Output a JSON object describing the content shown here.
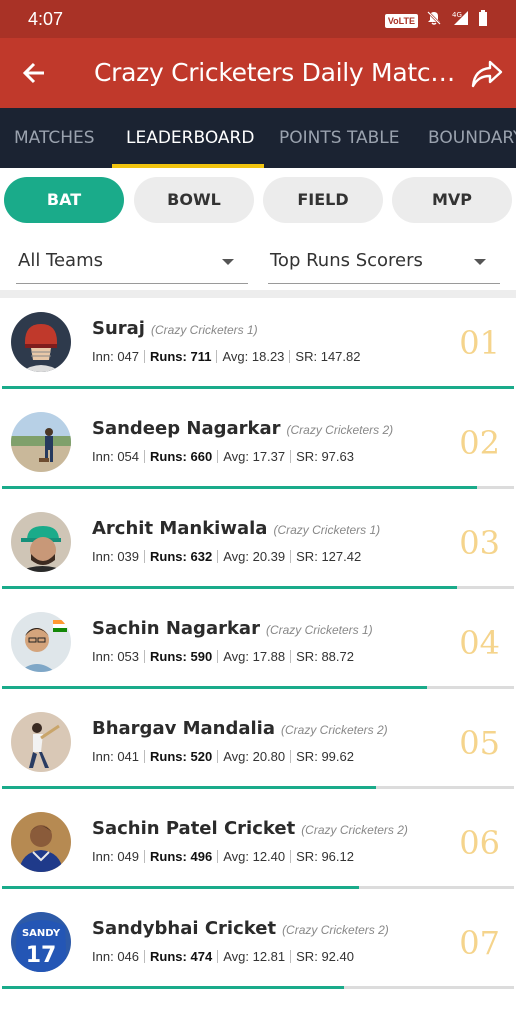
{
  "status_bar": {
    "time": "4:07",
    "volte": "VoLTE",
    "network": "4G"
  },
  "app_bar": {
    "title": "Crazy Cricketers Daily Match..."
  },
  "tabs": [
    {
      "label": "MATCHES"
    },
    {
      "label": "LEADERBOARD"
    },
    {
      "label": "POINTS TABLE"
    },
    {
      "label": "BOUNDARY"
    }
  ],
  "active_tab": "LEADERBOARD",
  "chips": [
    {
      "label": "BAT"
    },
    {
      "label": "BOWL"
    },
    {
      "label": "FIELD"
    },
    {
      "label": "MVP"
    }
  ],
  "active_chip": "BAT",
  "filters": {
    "team": "All Teams",
    "metric": "Top Runs Scorers"
  },
  "stat_labels": {
    "inn": "Inn:",
    "runs": "Runs:",
    "avg": "Avg:",
    "sr": "SR:"
  },
  "players": [
    {
      "rank": "01",
      "name": "Suraj",
      "team": "(Crazy Cricketers 1)",
      "inn": "047",
      "runs": "711",
      "avg": "18.23",
      "sr": "147.82",
      "progress": 1.0,
      "avatar": "helmet"
    },
    {
      "rank": "02",
      "name": "Sandeep Nagarkar",
      "team": "(Crazy Cricketers 2)",
      "inn": "054",
      "runs": "660",
      "avg": "17.37",
      "sr": "97.63",
      "progress": 0.928,
      "avatar": "field"
    },
    {
      "rank": "03",
      "name": "Archit Mankiwala",
      "team": "(Crazy Cricketers 1)",
      "inn": "039",
      "runs": "632",
      "avg": "20.39",
      "sr": "127.42",
      "progress": 0.889,
      "avatar": "cap"
    },
    {
      "rank": "04",
      "name": "Sachin Nagarkar",
      "team": "(Crazy Cricketers 1)",
      "inn": "053",
      "runs": "590",
      "avg": "17.88",
      "sr": "88.72",
      "progress": 0.83,
      "avatar": "selfie"
    },
    {
      "rank": "05",
      "name": "Bhargav Mandalia",
      "team": "(Crazy Cricketers 2)",
      "inn": "041",
      "runs": "520",
      "avg": "20.80",
      "sr": "99.62",
      "progress": 0.731,
      "avatar": "batting"
    },
    {
      "rank": "06",
      "name": "Sachin Patel Cricket",
      "team": "(Crazy Cricketers 2)",
      "inn": "049",
      "runs": "496",
      "avg": "12.40",
      "sr": "96.12",
      "progress": 0.698,
      "avatar": "jersey"
    },
    {
      "rank": "07",
      "name": "Sandybhai Cricket",
      "team": "(Crazy Cricketers 2)",
      "inn": "046",
      "runs": "474",
      "avg": "12.81",
      "sr": "92.40",
      "progress": 0.667,
      "avatar": "sandy"
    }
  ],
  "avatar_text": {
    "sandy_top": "SANDY",
    "sandy_num": "17"
  },
  "colors": {
    "status_bar": "#a93226",
    "app_bar": "#c0392b",
    "tab_bar": "#1b2332",
    "accent": "#1aab8a",
    "indicator": "#f1c40f",
    "rank": "#f5d48c"
  }
}
